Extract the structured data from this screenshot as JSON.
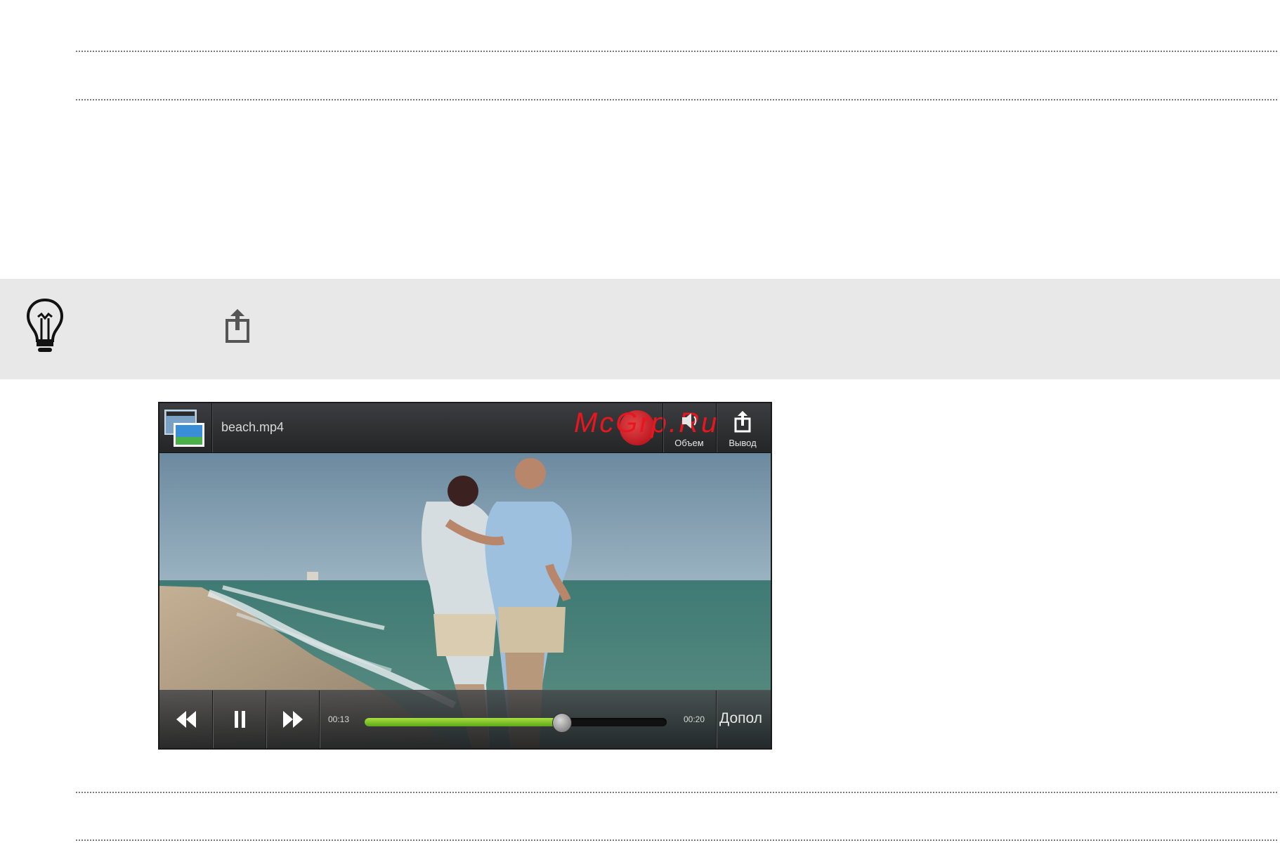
{
  "player": {
    "file_name": "beach.mp4",
    "watermark": "McGrp.Ru",
    "toolbar": {
      "volume_label": "Объем",
      "output_label": "Вывод"
    },
    "controls": {
      "elapsed": "00:13",
      "total": "00:20",
      "progress_fraction": 0.65,
      "more_label": "Допол"
    }
  },
  "icons": {
    "tip": "lightbulb-icon",
    "share": "share-icon"
  },
  "colors": {
    "progress": "#7cc428",
    "watermark": "#e8161e",
    "tip_band": "#e8e8e8"
  }
}
